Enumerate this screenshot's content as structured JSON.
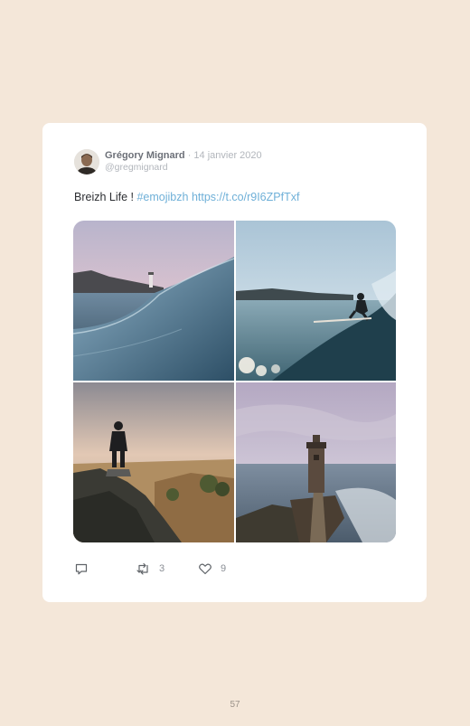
{
  "tweet": {
    "author_name": "Grégory Mignard",
    "separator": "·",
    "date": "14 janvier 2020",
    "handle": "@gregmignard",
    "text_plain": "Breizh Life ! ",
    "hashtag": "#emojibzh",
    "link": "https://t.co/r9I6ZPfTxf",
    "photos": [
      {
        "icon": "wave-lighthouse-photo"
      },
      {
        "icon": "surfer-photo"
      },
      {
        "icon": "hiker-with-dog-photo"
      },
      {
        "icon": "lighthouse-causeway-photo"
      }
    ],
    "actions": {
      "reply_icon": "reply-icon",
      "retweet_icon": "retweet-icon",
      "retweet_count": "3",
      "like_icon": "heart-icon",
      "like_count": "9"
    }
  },
  "page": {
    "number": "57"
  },
  "colors": {
    "background": "#f4e7d9",
    "card": "#ffffff",
    "link": "#6fb0d8",
    "muted": "#b2b6bc"
  }
}
